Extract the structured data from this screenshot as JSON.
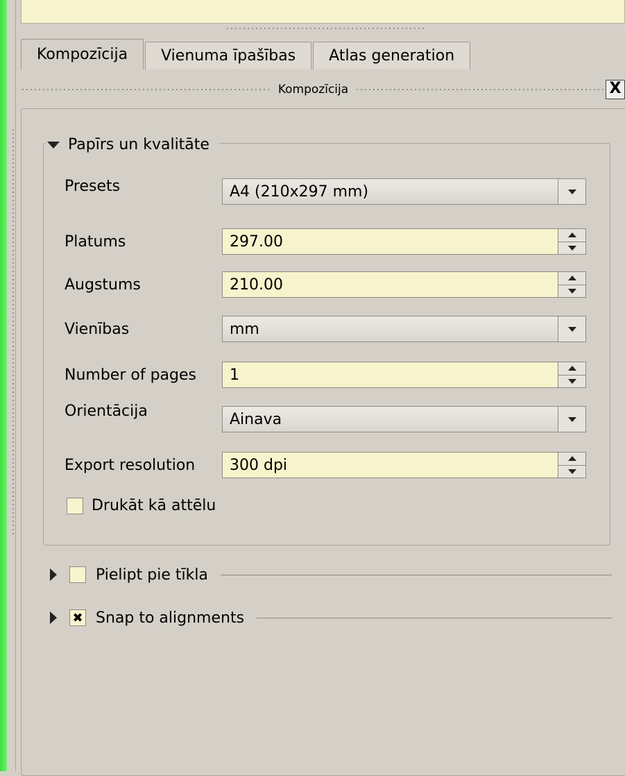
{
  "tabs": [
    {
      "label": "Kompozīcija",
      "active": true
    },
    {
      "label": "Vienuma īpašības",
      "active": false
    },
    {
      "label": "Atlas generation",
      "active": false
    }
  ],
  "dock": {
    "title": "Kompozīcija",
    "close_glyph": "X"
  },
  "group": {
    "title": "Papīrs un kvalitāte",
    "expanded": true
  },
  "fields": {
    "presets": {
      "label": "Presets",
      "value": "A4 (210x297 mm)"
    },
    "width": {
      "label": "Platums",
      "value": "297.00"
    },
    "height": {
      "label": "Augstums",
      "value": "210.00"
    },
    "units": {
      "label": "Vienības",
      "value": "mm"
    },
    "pages": {
      "label": "Number of pages",
      "value": "1"
    },
    "orientation": {
      "label": "Orientācija",
      "value": "Ainava"
    },
    "resolution": {
      "label": "Export resolution",
      "value": "300 dpi"
    }
  },
  "print_as_image": {
    "label": "Drukāt kā attēlu",
    "checked": false
  },
  "snap_grid": {
    "label": "Pielipt pie tīkla",
    "checked": false
  },
  "snap_align": {
    "label": "Snap to alignments",
    "checked": true,
    "mark": "✖"
  },
  "colors": {
    "field_bg": "#f7f3cc",
    "window_bg": "#d4d0c8",
    "accent_green": "#3fe03f"
  }
}
